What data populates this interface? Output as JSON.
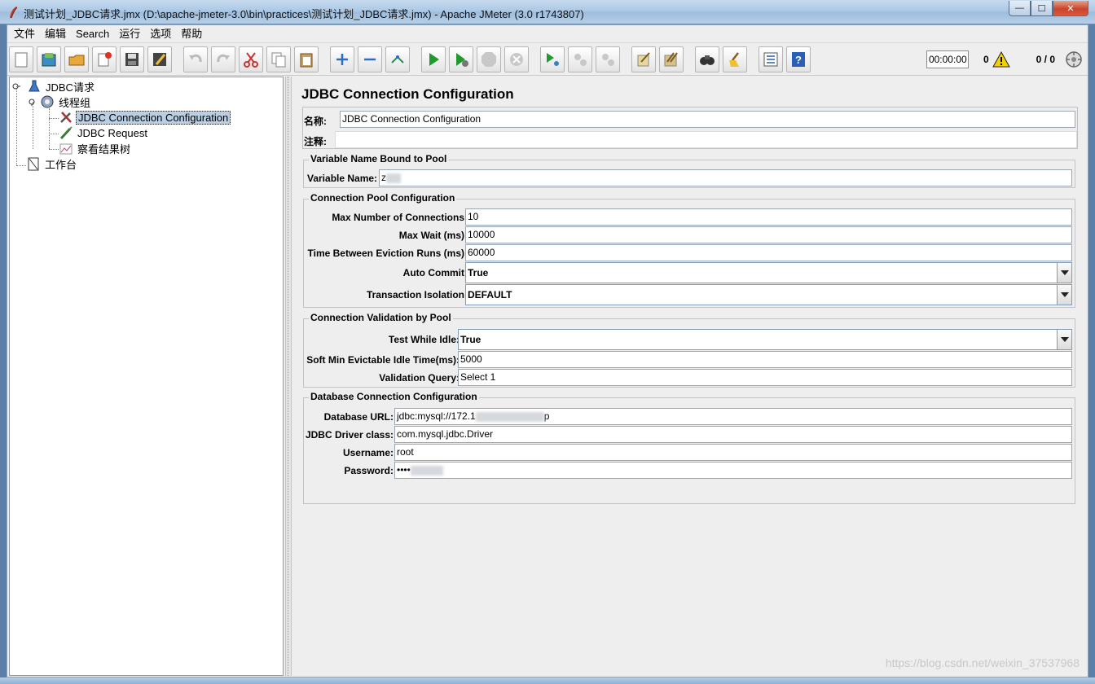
{
  "window": {
    "title": "测试计划_JDBC请求.jmx (D:\\apache-jmeter-3.0\\bin\\practices\\测试计划_JDBC请求.jmx) - Apache JMeter (3.0 r1743807)",
    "min_symbol": "—",
    "max_symbol": "☐",
    "close_symbol": "✕"
  },
  "menu": [
    "文件",
    "编辑",
    "Search",
    "运行",
    "选项",
    "帮助"
  ],
  "toolbar": {
    "buttons": [
      "new-icon",
      "templates-icon",
      "open-icon",
      "close-file-icon",
      "save-icon",
      "save-as-icon",
      "undo-icon",
      "redo-icon",
      "cut-icon",
      "copy-icon",
      "paste-icon",
      "expand-icon",
      "collapse-icon",
      "toggle-icon",
      "start-icon",
      "start-no-pause-icon",
      "stop-icon",
      "shutdown-icon",
      "remote-start-icon",
      "remote-stop-icon",
      "remote-shutdown-icon",
      "clear-icon",
      "clear-all-icon",
      "search-icon",
      "reset-search-icon",
      "function-helper-icon",
      "help-icon"
    ],
    "timer": "00:00:00",
    "warning_count": "0",
    "threads": "0 / 0"
  },
  "tree": {
    "test_plan": "JDBC请求",
    "thread_group": "线程组",
    "jdbc_config": "JDBC Connection Configuration",
    "jdbc_request": "JDBC Request",
    "result_tree": "察看结果树",
    "workbench": "工作台"
  },
  "panel": {
    "title": "JDBC Connection Configuration",
    "name_label": "名称:",
    "name_value": "JDBC Connection Configuration",
    "comment_label": "注释:",
    "comment_value": "",
    "group1": {
      "title": "Variable Name Bound to Pool",
      "var_label": "Variable Name:",
      "var_value": "z"
    },
    "group2": {
      "title": "Connection Pool Configuration",
      "max_conn_label": "Max Number of Connections:",
      "max_conn_value": "10",
      "max_wait_label": "Max Wait (ms):",
      "max_wait_value": "10000",
      "eviction_label": "Time Between Eviction Runs (ms):",
      "eviction_value": "60000",
      "auto_commit_label": "Auto Commit:",
      "auto_commit_value": "True",
      "isolation_label": "Transaction Isolation:",
      "isolation_value": "DEFAULT"
    },
    "group3": {
      "title": "Connection Validation by Pool",
      "test_idle_label": "Test While Idle:",
      "test_idle_value": "True",
      "soft_min_label": "Soft Min Evictable Idle Time(ms):",
      "soft_min_value": "5000",
      "validation_label": "Validation Query:",
      "validation_value": "Select 1"
    },
    "group4": {
      "title": "Database Connection Configuration",
      "url_label": "Database URL:",
      "url_value": "jdbc:mysql://172.1",
      "url_tail": "p",
      "driver_label": "JDBC Driver class:",
      "driver_value": "com.mysql.jdbc.Driver",
      "user_label": "Username:",
      "user_value": "root",
      "pass_label": "Password:",
      "pass_value": "••••"
    }
  },
  "watermark": "https://blog.csdn.net/weixin_37537968"
}
